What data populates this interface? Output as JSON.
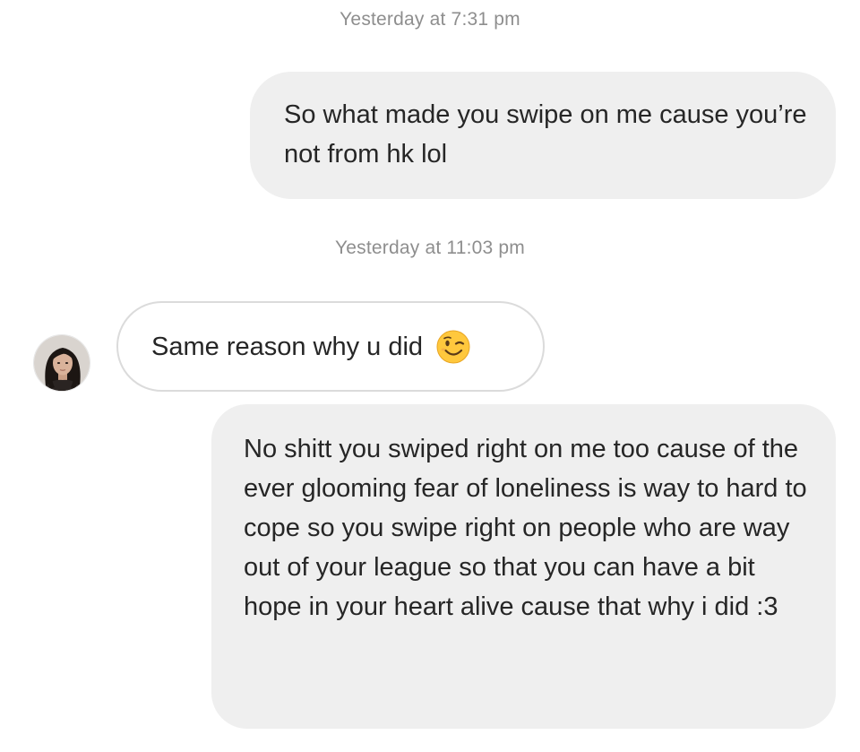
{
  "thread": {
    "timestamp_1": "Yesterday at 7:31 pm",
    "message_1": "So what made you swipe on me cause you’re not from hk lol",
    "timestamp_2": "Yesterday at 11:03 pm",
    "message_2": "Same reason why u did",
    "message_2_emoji": "winking-face-icon",
    "message_3": "No shitt you swiped right on me too cause of the ever glooming fear of loneliness is way to hard to cope so you swipe right on people who are way out of your league so that you can have a bit hope in your heart alive cause that why i did :3"
  },
  "colors": {
    "outgoing_bubble": "#efefef",
    "incoming_bubble_border": "#dbdbdb",
    "timestamp_text": "#8e8e8e",
    "message_text": "#262626",
    "emoji_face": "#ffc83d"
  }
}
